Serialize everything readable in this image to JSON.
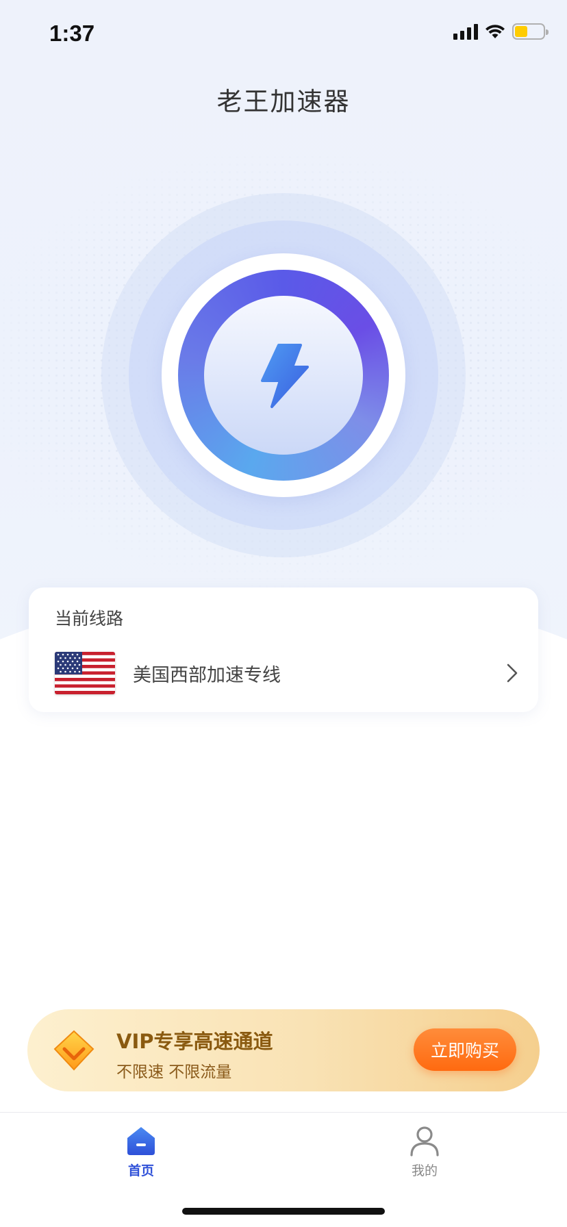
{
  "status_bar": {
    "time": "1:37",
    "icons": [
      "signal-icon",
      "wifi-icon",
      "battery-icon"
    ],
    "battery_color": "#ffcc00"
  },
  "header": {
    "title": "老王加速器"
  },
  "accelerator": {
    "icon": "lightning-bolt-icon",
    "accent_colors": [
      "#5aa8ee",
      "#5a5ae8",
      "#6a4ee6"
    ]
  },
  "route_card": {
    "label": "当前线路",
    "current_route": {
      "flag": "us-flag-icon",
      "name": "美国西部加速专线",
      "chevron": "chevron-right-icon"
    }
  },
  "vip_banner": {
    "icon": "diamond-icon",
    "title": "VIP专享高速通道",
    "subtitle": "不限速 不限流量",
    "button_label": "立即购买",
    "button_color": "#ff6a10"
  },
  "tab_bar": {
    "tabs": [
      {
        "label": "首页",
        "icon": "home-icon",
        "active": true
      },
      {
        "label": "我的",
        "icon": "user-icon",
        "active": false
      }
    ],
    "active_color": "#2e50d8",
    "inactive_color": "#888888"
  }
}
